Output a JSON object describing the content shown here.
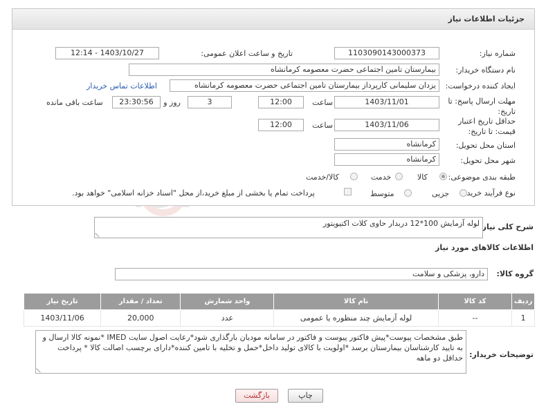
{
  "panel": {
    "title": "جزئیات اطلاعات نیاز"
  },
  "labels": {
    "need_number": "شماره نیاز:",
    "announce_datetime": "تاریخ و ساعت اعلان عمومی:",
    "buyer_org": "نام دستگاه خریدار:",
    "requester": "ایجاد کننده درخواست:",
    "reply_deadline": "مهلت ارسال پاسخ: تا تاریخ:",
    "hour": "ساعت",
    "day_and": "روز و",
    "hours_left": "ساعت باقی مانده",
    "price_validity": "حداقل تاریخ اعتبار قیمت: تا تاریخ:",
    "province": "استان محل تحویل:",
    "city": "شهر محل تحویل:",
    "category": "طبقه بندی موضوعی:",
    "process_type": "نوع فرآیند خرید :"
  },
  "values": {
    "need_number": "1103090143000373",
    "announce_datetime": "1403/10/27 - 12:14",
    "buyer_org": "بیمارستان تامین اجتماعی حضرت معصومه کرمانشاه",
    "requester": "یزدان  سلیمانی کارپرداز بیمارستان تامین اجتماعی حضرت معصومه کرمانشاه",
    "reply_date": "1403/11/01",
    "reply_time": "12:00",
    "days": "3",
    "remaining_time": "23:30:56",
    "price_date": "1403/11/06",
    "price_time": "12:00",
    "province": "کرمانشاه",
    "city": "کرمانشاه"
  },
  "contact_link": "اطلاعات تماس خریدار",
  "category_options": [
    {
      "label": "کالا",
      "selected": true
    },
    {
      "label": "خدمت",
      "selected": false
    },
    {
      "label": "کالا/خدمت",
      "selected": false
    }
  ],
  "process_options": [
    {
      "label": "جزیی",
      "selected": false
    },
    {
      "label": "متوسط",
      "selected": false
    }
  ],
  "payment_note": "پرداخت تمام یا بخشی از مبلغ خرید،از محل \"اسناد خزانه اسلامی\" خواهد بود.",
  "general_description": {
    "label": "شرح کلی نیاز:",
    "value": "لوله آزمایش 100*12 دربدار حاوی کلات اکتیویتور"
  },
  "goods_info_title": "اطلاعات کالاهای مورد نیاز",
  "goods_group": {
    "label": "گروه کالا:",
    "value": "دارو، پزشکی و سلامت"
  },
  "table": {
    "headers": [
      "ردیف",
      "کد کالا",
      "نام کالا",
      "واحد شمارش",
      "تعداد / مقدار",
      "تاریخ نیاز"
    ],
    "rows": [
      [
        "1",
        "--",
        "لوله آزمایش چند منظوره یا عمومی",
        "عدد",
        "20,000",
        "1403/11/06"
      ]
    ]
  },
  "buyer_notes": {
    "label": "توضیحات خریدار:",
    "value": "طبق مشخصات پیوست*پیش فاکتور پیوست و فاکتور در سامانه مودیان بارگذاری شود*رعایت اصول سایت IMED *نمونه کالا ارسال و به تایید کارشناسان بیمارستان برسد *اولویت با کالای تولید داخل*حمل و تخلیه با تامین کننده*دارای برچسب اصالت کالا * پرداخت حداقل دو ماهه"
  },
  "buttons": {
    "print": "چاپ",
    "back": "بازگشت"
  },
  "watermark": {
    "text": "AriaTender.net"
  },
  "colors": {
    "header_gray": "#9c9c9c",
    "link_blue": "#2a5db0",
    "back_button_red": "#b03030"
  }
}
